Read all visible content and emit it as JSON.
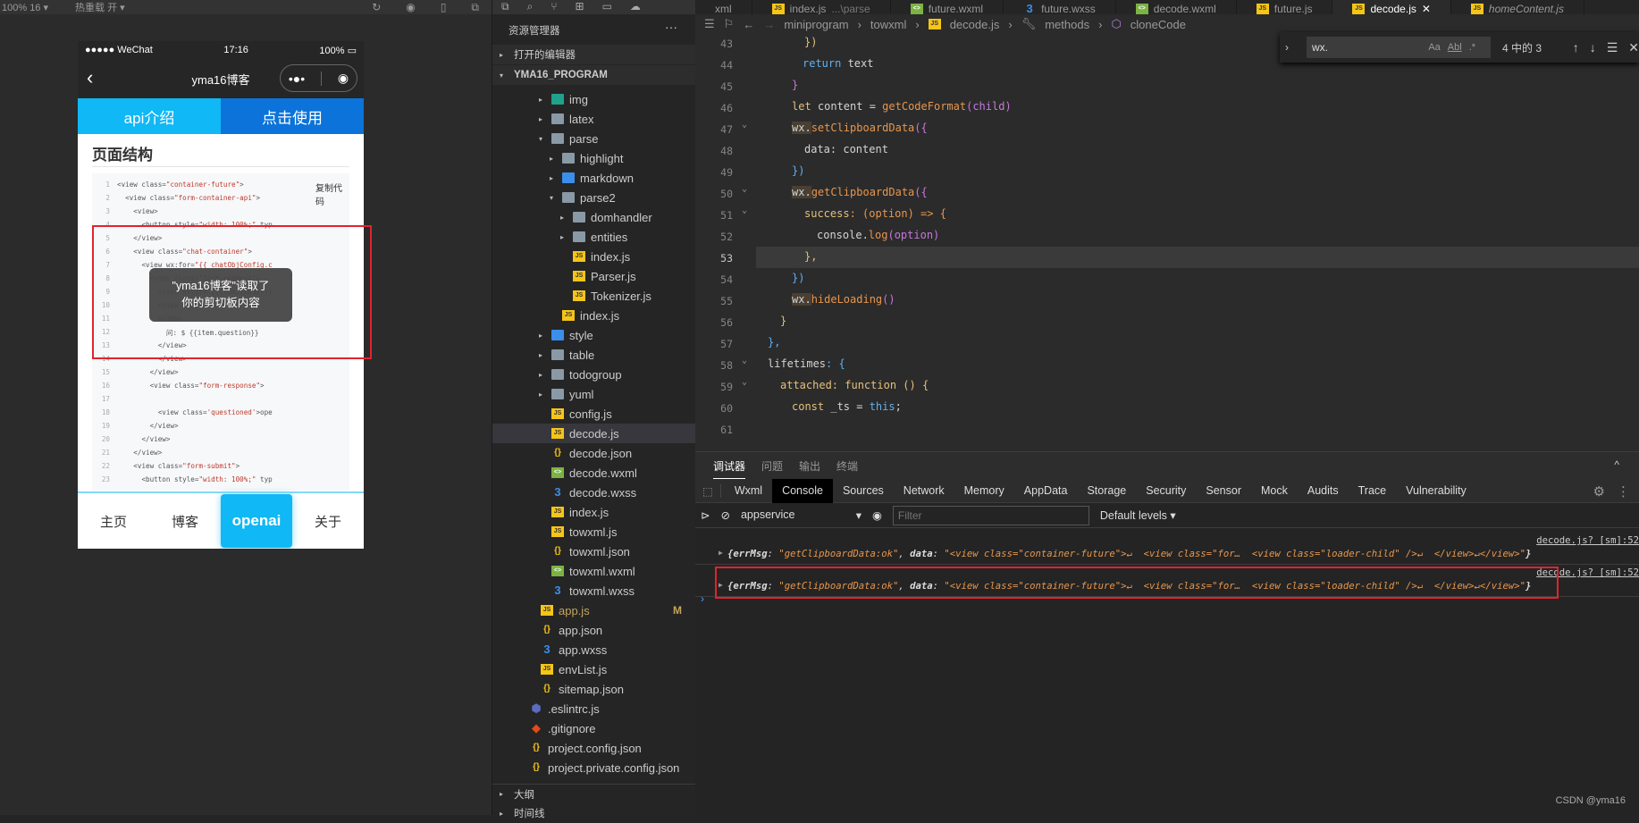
{
  "simulator": {
    "toolbar": {
      "zoom": "100% 16 ▾",
      "hot_reload": "热重载 开 ▾"
    },
    "status_bar": {
      "carrier": "●●●●● WeChat",
      "time": "17:16",
      "battery": "100%"
    },
    "nav": {
      "title": "yma16博客",
      "capsule_more": "•●•",
      "capsule_close": "◉"
    },
    "tabs": [
      "api介绍",
      "点击使用"
    ],
    "page_heading": "页面结构",
    "copy_code": "复制代码",
    "code_lines": [
      {
        "n": "1",
        "indent": "",
        "pre": "<view class=",
        "str": "\"container-future\"",
        "post": ">"
      },
      {
        "n": "2",
        "indent": "  ",
        "pre": "<view class=",
        "str": "\"form-container-api\"",
        "post": ">"
      },
      {
        "n": "3",
        "indent": "    ",
        "pre": "<view>",
        "str": "",
        "post": ""
      },
      {
        "n": "4",
        "indent": "      ",
        "pre": "<button style=",
        "str": "\"width: 100%;\"",
        "post": " typ"
      },
      {
        "n": "5",
        "indent": "    ",
        "pre": "</view>",
        "str": "",
        "post": ""
      },
      {
        "n": "6",
        "indent": "    ",
        "pre": "<view class=",
        "str": "\"chat-container\"",
        "post": ">"
      },
      {
        "n": "7",
        "indent": "      ",
        "pre": "<view wx:for=",
        "str": "\"{{ chatObjConfig.c",
        "post": ""
      },
      {
        "n": "8",
        "indent": "        ",
        "pre": "<view class=",
        "str": "\"form-request\"",
        "post": ">"
      },
      {
        "n": "9",
        "indent": "          ",
        "pre": "<view wx:if=",
        "str": "\"{{item.isEdit}}",
        "post": ""
      },
      {
        "n": "10",
        "indent": "          ",
        "pre": "<view ",
        "str": "question",
        "post": ""
      },
      {
        "n": "11",
        "indent": "          ",
        "pre": "<view>",
        "str": "",
        "post": ""
      },
      {
        "n": "12",
        "indent": "            ",
        "pre": "问: $ {{item.question}}",
        "str": "",
        "post": ""
      },
      {
        "n": "13",
        "indent": "          ",
        "pre": "</view>",
        "str": "",
        "post": ""
      },
      {
        "n": "14",
        "indent": "          ",
        "pre": "</view>",
        "str": "",
        "post": ""
      },
      {
        "n": "15",
        "indent": "        ",
        "pre": "</view>",
        "str": "",
        "post": ""
      },
      {
        "n": "16",
        "indent": "        ",
        "pre": "<view class=",
        "str": "\"form-response\"",
        "post": ">"
      },
      {
        "n": "17",
        "indent": "",
        "pre": "",
        "str": "",
        "post": ""
      },
      {
        "n": "18",
        "indent": "          ",
        "pre": "<view class=",
        "str": "'questioned'",
        "post": ">ope"
      },
      {
        "n": "19",
        "indent": "        ",
        "pre": "</view>",
        "str": "",
        "post": ""
      },
      {
        "n": "20",
        "indent": "      ",
        "pre": "</view>",
        "str": "",
        "post": ""
      },
      {
        "n": "21",
        "indent": "    ",
        "pre": "</view>",
        "str": "",
        "post": ""
      },
      {
        "n": "22",
        "indent": "    ",
        "pre": "<view class=",
        "str": "\"form-submit\"",
        "post": ">"
      },
      {
        "n": "23",
        "indent": "      ",
        "pre": "<button style=",
        "str": "\"width: 100%;\"",
        "post": " typ"
      }
    ],
    "toast": {
      "line1": "\"yma16博客\"读取了",
      "line2": "你的剪切板内容"
    },
    "tabbar": [
      "主页",
      "博客",
      "openai",
      "关于"
    ],
    "tabbar_active": 2
  },
  "explorer": {
    "title": "资源管理器",
    "more": "···",
    "open_editors": "打开的编辑器",
    "project": "YMA16_PROGRAM",
    "tree": [
      {
        "name": "img",
        "type": "folder-teal",
        "depth": 2,
        "arrow": "▸"
      },
      {
        "name": "latex",
        "type": "folder",
        "depth": 2,
        "arrow": "▸"
      },
      {
        "name": "parse",
        "type": "folder",
        "depth": 2,
        "arrow": "▾"
      },
      {
        "name": "highlight",
        "type": "folder",
        "depth": 3,
        "arrow": "▸"
      },
      {
        "name": "markdown",
        "type": "folder-blue",
        "depth": 3,
        "arrow": "▸"
      },
      {
        "name": "parse2",
        "type": "folder",
        "depth": 3,
        "arrow": "▾"
      },
      {
        "name": "domhandler",
        "type": "folder",
        "depth": 4,
        "arrow": "▸"
      },
      {
        "name": "entities",
        "type": "folder",
        "depth": 4,
        "arrow": "▸"
      },
      {
        "name": "index.js",
        "type": "js",
        "depth": 4,
        "arrow": ""
      },
      {
        "name": "Parser.js",
        "type": "js",
        "depth": 4,
        "arrow": ""
      },
      {
        "name": "Tokenizer.js",
        "type": "js",
        "depth": 4,
        "arrow": ""
      },
      {
        "name": "index.js",
        "type": "js",
        "depth": 3,
        "arrow": ""
      },
      {
        "name": "style",
        "type": "folder-blue",
        "depth": 2,
        "arrow": "▸"
      },
      {
        "name": "table",
        "type": "folder",
        "depth": 2,
        "arrow": "▸"
      },
      {
        "name": "todogroup",
        "type": "folder",
        "depth": 2,
        "arrow": "▸"
      },
      {
        "name": "yuml",
        "type": "folder",
        "depth": 2,
        "arrow": "▸"
      },
      {
        "name": "config.js",
        "type": "js",
        "depth": 2,
        "arrow": ""
      },
      {
        "name": "decode.js",
        "type": "js",
        "depth": 2,
        "arrow": "",
        "selected": true
      },
      {
        "name": "decode.json",
        "type": "json",
        "depth": 2,
        "arrow": ""
      },
      {
        "name": "decode.wxml",
        "type": "wxml",
        "depth": 2,
        "arrow": ""
      },
      {
        "name": "decode.wxss",
        "type": "wxss",
        "depth": 2,
        "arrow": ""
      },
      {
        "name": "index.js",
        "type": "js",
        "depth": 2,
        "arrow": ""
      },
      {
        "name": "towxml.js",
        "type": "js",
        "depth": 2,
        "arrow": ""
      },
      {
        "name": "towxml.json",
        "type": "json",
        "depth": 2,
        "arrow": ""
      },
      {
        "name": "towxml.wxml",
        "type": "wxml",
        "depth": 2,
        "arrow": ""
      },
      {
        "name": "towxml.wxss",
        "type": "wxss",
        "depth": 2,
        "arrow": ""
      },
      {
        "name": "app.js",
        "type": "js",
        "depth": 1,
        "arrow": "",
        "badge": "M"
      },
      {
        "name": "app.json",
        "type": "json",
        "depth": 1,
        "arrow": ""
      },
      {
        "name": "app.wxss",
        "type": "wxss",
        "depth": 1,
        "arrow": ""
      },
      {
        "name": "envList.js",
        "type": "js",
        "depth": 1,
        "arrow": ""
      },
      {
        "name": "sitemap.json",
        "type": "json",
        "depth": 1,
        "arrow": ""
      },
      {
        "name": ".eslintrc.js",
        "type": "eslint",
        "depth": 0,
        "arrow": ""
      },
      {
        "name": ".gitignore",
        "type": "git",
        "depth": 0,
        "arrow": ""
      },
      {
        "name": "project.config.json",
        "type": "json",
        "depth": 0,
        "arrow": ""
      },
      {
        "name": "project.private.config.json",
        "type": "json",
        "depth": 0,
        "arrow": ""
      }
    ],
    "outline": "大纲",
    "timeline": "时间线"
  },
  "editor": {
    "tabs": [
      {
        "label": "xml",
        "icon": "",
        "hint": ""
      },
      {
        "label": "index.js",
        "icon": "js",
        "hint": "...\\parse"
      },
      {
        "label": "future.wxml",
        "icon": "wxml",
        "hint": ""
      },
      {
        "label": "future.wxss",
        "icon": "wxss",
        "hint": ""
      },
      {
        "label": "decode.wxml",
        "icon": "wxml",
        "hint": ""
      },
      {
        "label": "future.js",
        "icon": "js",
        "hint": ""
      },
      {
        "label": "decode.js",
        "icon": "js",
        "hint": "",
        "active": true,
        "close": "✕"
      },
      {
        "label": "homeContent.js",
        "icon": "js",
        "hint": "",
        "italic": true
      }
    ],
    "breadcrumb": [
      "miniprogram",
      "towxml",
      "decode.js",
      "methods",
      "cloneCode"
    ],
    "find": {
      "value": "wx.",
      "match_case": "Aa",
      "whole_word": "Abl",
      "regex": ".*",
      "count": "4 中的 3"
    },
    "current_line": "53",
    "lines": [
      {
        "n": "43",
        "fold": false
      },
      {
        "n": "44",
        "fold": false
      },
      {
        "n": "45",
        "fold": false
      },
      {
        "n": "46",
        "fold": false
      },
      {
        "n": "47",
        "fold": true
      },
      {
        "n": "48",
        "fold": false
      },
      {
        "n": "49",
        "fold": false
      },
      {
        "n": "50",
        "fold": true
      },
      {
        "n": "51",
        "fold": true
      },
      {
        "n": "52",
        "fold": false
      },
      {
        "n": "53",
        "fold": false
      },
      {
        "n": "54",
        "fold": false
      },
      {
        "n": "55",
        "fold": false
      },
      {
        "n": "56",
        "fold": false
      },
      {
        "n": "57",
        "fold": false
      },
      {
        "n": "58",
        "fold": true
      },
      {
        "n": "59",
        "fold": true
      },
      {
        "n": "60",
        "fold": false
      },
      {
        "n": "61",
        "fold": false
      }
    ],
    "code": {
      "l43": "})",
      "l44_kw": "return",
      "l44_rest": " text",
      "l45": "}",
      "l46_kw": "let",
      "l46_var": " content = ",
      "l46_fn": "getCodeFormat",
      "l46_args": "(child)",
      "l47_wx": "wx.",
      "l47_fn": "setClipboardData",
      "l47_rest": "({",
      "l48": "data: content",
      "l49": "})",
      "l50_wx": "wx.",
      "l50_fn": "getClipboardData",
      "l50_rest": "({",
      "l51_key": "success",
      "l51_rest": ": (option) => {",
      "l52_obj": "console.",
      "l52_fn": "log",
      "l52_rest": "(option)",
      "l53": "},",
      "l54": "})",
      "l55_wx": "wx.",
      "l55_fn": "hideLoading",
      "l55_rest": "()",
      "l56": "}",
      "l57": "},",
      "l58_key": "lifetimes",
      "l58_rest": ": {",
      "l59_key": "attached",
      "l59_kw": ": function",
      "l59_rest": " () {",
      "l60_kw": "const",
      "l60_var": " _ts = ",
      "l60_this": "this",
      "l60_end": ";"
    }
  },
  "devtools": {
    "top_tabs": [
      "调试器",
      "问题",
      "输出",
      "终端"
    ],
    "collapse": "^",
    "tabs": [
      "Wxml",
      "Console",
      "Sources",
      "Network",
      "Memory",
      "AppData",
      "Storage",
      "Security",
      "Sensor",
      "Mock",
      "Audits",
      "Trace",
      "Vulnerability"
    ],
    "active_tab": "Console",
    "context": "appservice",
    "filter_placeholder": "Filter",
    "levels": "Default levels ▾",
    "logs": [
      {
        "source": "decode.js? [sm]:52",
        "k1": "{errMsg",
        "v1": "\"getClipboardData:ok\"",
        "k2": "data",
        "v2": "\"<view class=\"container-future\">↵  <view class=\"for…  <view class=\"loader-child\" />↵  </view>↵</view>\"",
        "end": "}"
      },
      {
        "source": "decode.js? [sm]:52",
        "k1": "{errMsg",
        "v1": "\"getClipboardData:ok\"",
        "k2": "data",
        "v2": "\"<view class=\"container-future\">↵  <view class=\"for…  <view class=\"loader-child\" />↵  </view>↵</view>\"",
        "end": "}"
      }
    ],
    "prompt": "›"
  },
  "watermark": "CSDN @yma16",
  "colors": {
    "accent_blue": "#10b8f5",
    "dark_blue": "#0b73d9",
    "highlight_red": "#e0242c"
  }
}
